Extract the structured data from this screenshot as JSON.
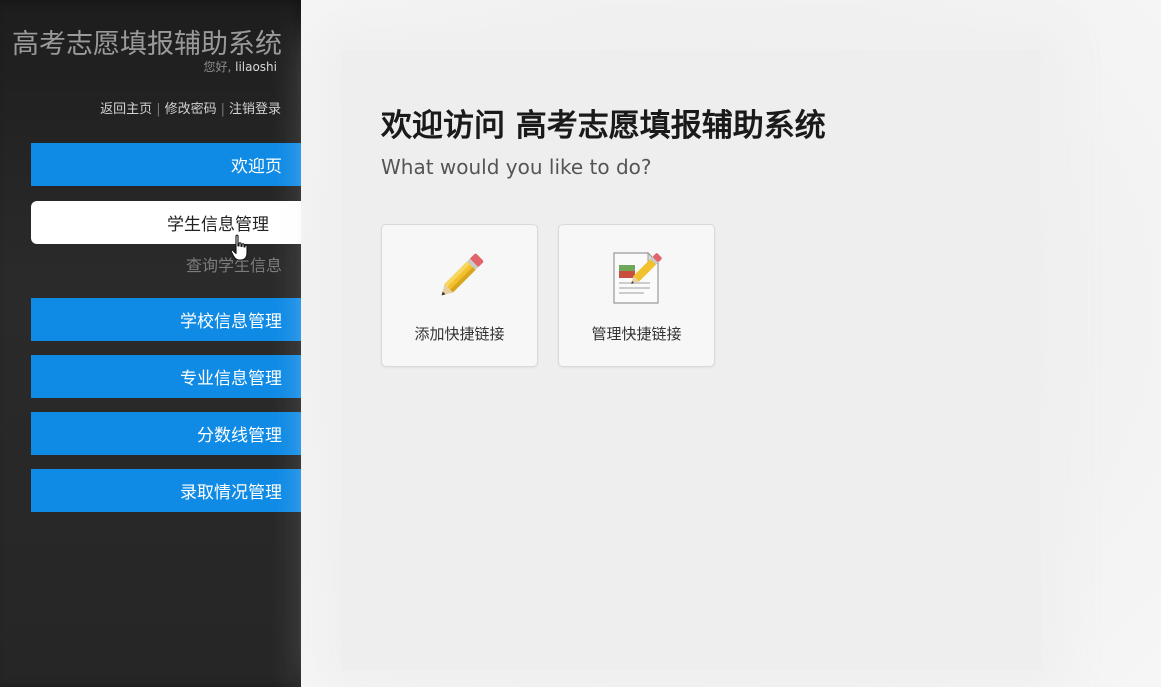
{
  "sidebar": {
    "brand": "高考志愿填报辅助系统",
    "greeting_prefix": "您好,",
    "username": "lilaoshi",
    "links": {
      "home": "返回主页",
      "sep1": "|",
      "change_password": "修改密码",
      "sep2": "|",
      "logout": "注销登录"
    },
    "menu": {
      "welcome": "欢迎页",
      "student": "学生信息管理",
      "student_sub_query": "查询学生信息",
      "school": "学校信息管理",
      "major": "专业信息管理",
      "score_line": "分数线管理",
      "admission": "录取情况管理"
    }
  },
  "main": {
    "title": "欢迎访问 高考志愿填报辅助系统",
    "subtitle": "What would you like to do?",
    "shortcuts": {
      "add_label": "添加快捷链接",
      "manage_label": "管理快捷链接"
    }
  },
  "colors": {
    "menu_blue": "#0f8be6",
    "sidebar_bg": "#262626",
    "main_bg": "#f1f1f1"
  },
  "icons": {
    "add": "pencil-icon",
    "manage": "edit-document-icon",
    "cursor": "hand-pointer-icon"
  }
}
